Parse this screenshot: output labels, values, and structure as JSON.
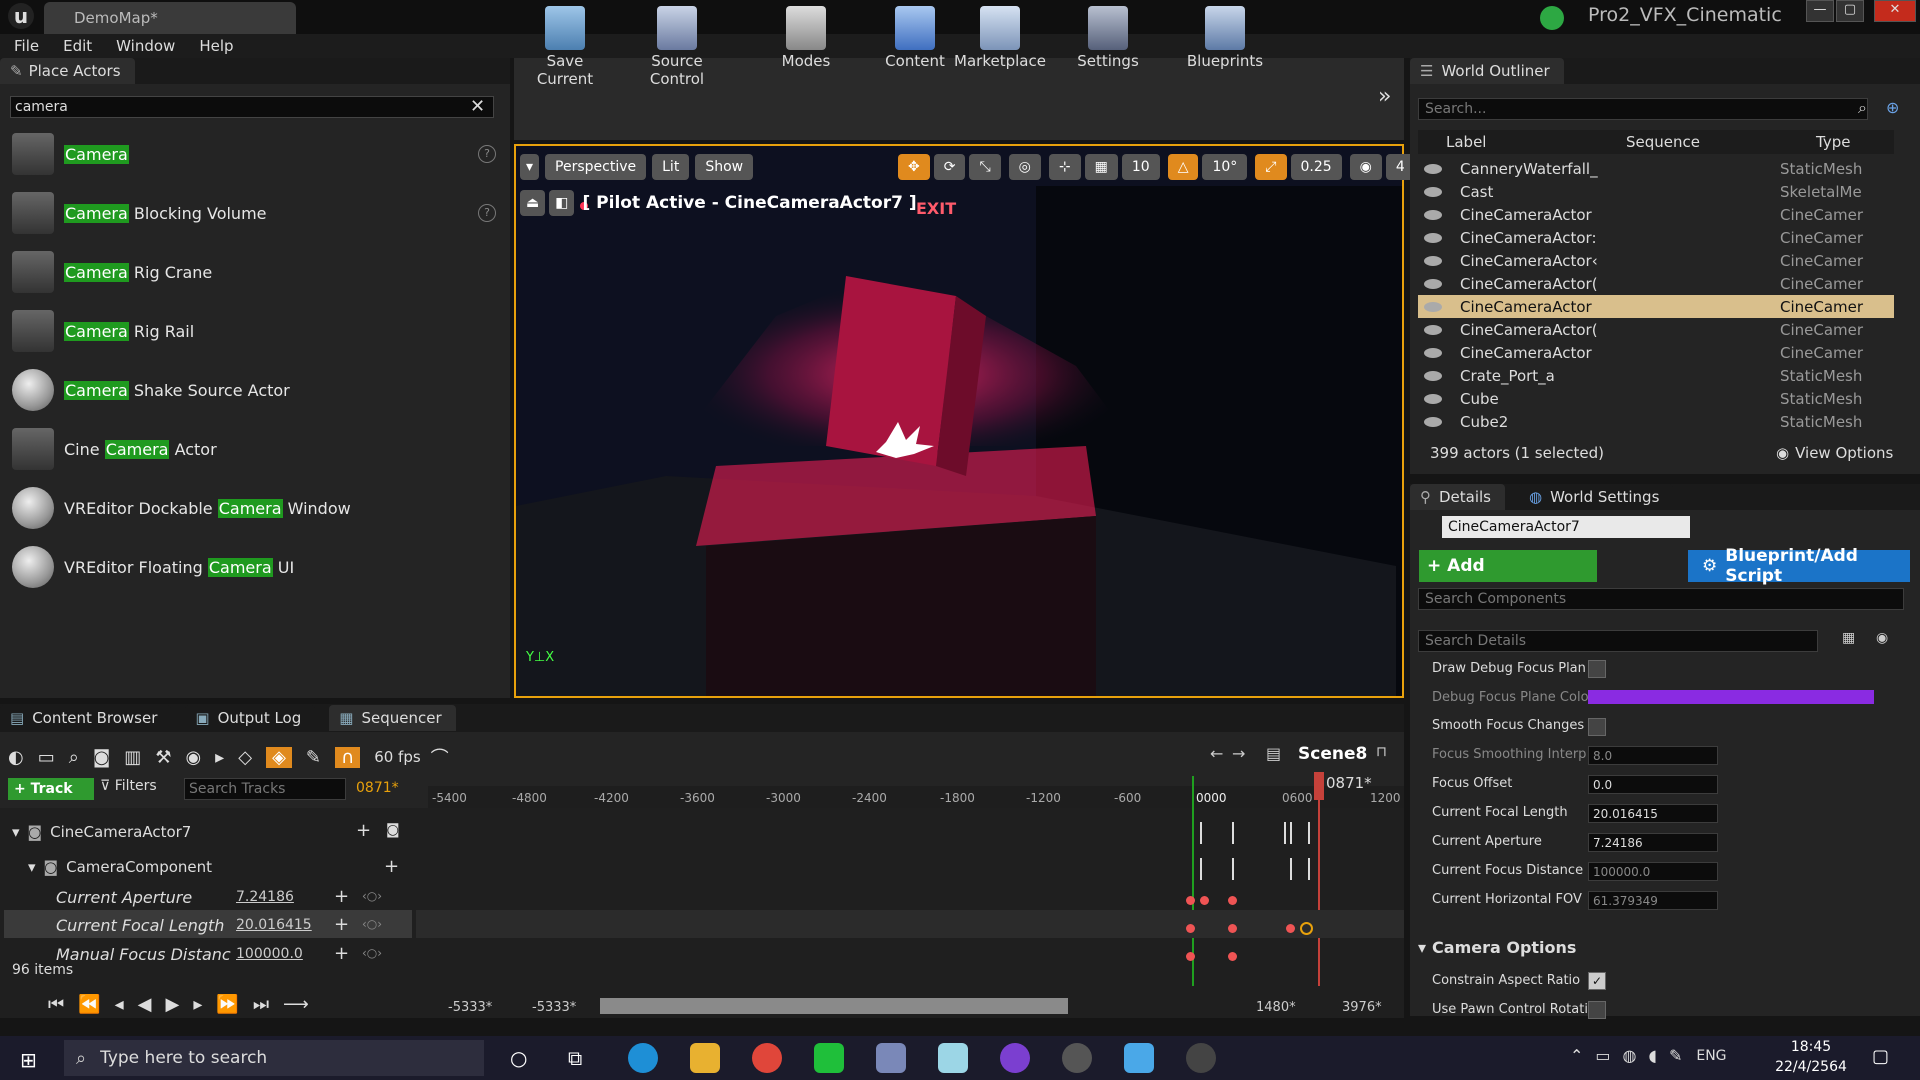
{
  "window": {
    "doc_tab": "DemoMap*",
    "project_name": "Pro2_VFX_Cinematic",
    "min": "—",
    "max": "▢",
    "close": "✕"
  },
  "menu": [
    "File",
    "Edit",
    "Window",
    "Help"
  ],
  "place_actors": {
    "tab": "Place Actors",
    "search_value": "camera",
    "items": [
      {
        "pre": "",
        "hl": "Camera",
        "post": ""
      },
      {
        "pre": "",
        "hl": "Camera",
        "post": " Blocking Volume"
      },
      {
        "pre": "",
        "hl": "Camera",
        "post": " Rig Crane"
      },
      {
        "pre": "",
        "hl": "Camera",
        "post": " Rig Rail"
      },
      {
        "pre": "",
        "hl": "Camera",
        "post": " Shake Source Actor"
      },
      {
        "pre": "Cine ",
        "hl": "Camera",
        "post": " Actor"
      },
      {
        "pre": "VREditor Dockable ",
        "hl": "Camera",
        "post": " Window"
      },
      {
        "pre": "VREditor Floating ",
        "hl": "Camera",
        "post": " UI"
      }
    ]
  },
  "toolbar": [
    "Save Current",
    "Source Control",
    "Modes",
    "Content",
    "Marketplace",
    "Settings",
    "Blueprints"
  ],
  "viewport": {
    "perspective": "Perspective",
    "lit": "Lit",
    "show": "Show",
    "grid": "10",
    "angle": "10°",
    "scale": "0.25",
    "cam_speed": "4",
    "pilot": "[ Pilot Active - CineCameraActor7 ]",
    "exit_sign": "EXIT"
  },
  "outliner": {
    "tab": "World Outliner",
    "search_placeholder": "Search...",
    "col_label": "Label",
    "col_sequence": "Sequence",
    "col_type": "Type",
    "rows": [
      {
        "label": "CanneryWaterfall_",
        "type": "StaticMesh"
      },
      {
        "label": "Cast",
        "type": "SkeletalMe"
      },
      {
        "label": "CineCameraActor",
        "type": "CineCamer"
      },
      {
        "label": "CineCameraActor:",
        "type": "CineCamer"
      },
      {
        "label": "CineCameraActor‹",
        "type": "CineCamer"
      },
      {
        "label": "CineCameraActor(",
        "type": "CineCamer"
      },
      {
        "label": "CineCameraActor",
        "type": "CineCamer"
      },
      {
        "label": "CineCameraActor(",
        "type": "CineCamer"
      },
      {
        "label": "CineCameraActor",
        "type": "CineCamer"
      },
      {
        "label": "Crate_Port_a",
        "type": "StaticMesh"
      },
      {
        "label": "Cube",
        "type": "StaticMesh"
      },
      {
        "label": "Cube2",
        "type": "StaticMesh"
      }
    ],
    "status": "399 actors (1 selected)",
    "view_options": "View Options"
  },
  "details": {
    "tab": "Details",
    "tab2": "World Settings",
    "actor_name": "CineCameraActor7",
    "add_component": "+ Add Component",
    "blueprint": "Blueprint/Add Script",
    "search_components": "Search Components",
    "search_details": "Search Details",
    "props": [
      {
        "label": "Draw Debug Focus Plan"
      },
      {
        "label": "Debug Focus Plane Colo"
      },
      {
        "label": "Smooth Focus Changes"
      },
      {
        "label": "Focus Smoothing Interp",
        "value": "8.0"
      },
      {
        "label": "Focus Offset",
        "value": "0.0"
      },
      {
        "label": "Current Focal Length",
        "value": "20.016415"
      },
      {
        "label": "Current Aperture",
        "value": "7.24186"
      },
      {
        "label": "Current Focus Distance",
        "value": "100000.0"
      },
      {
        "label": "Current Horizontal FOV",
        "value": "61.379349"
      }
    ],
    "camera_options": "Camera Options",
    "constrain": "Constrain Aspect Ratio",
    "use_pawn": "Use Pawn Control Rotatior"
  },
  "bottom_tabs": [
    "Content Browser",
    "Output Log",
    "Sequencer"
  ],
  "sequencer": {
    "fps": "60 fps",
    "scene": "Scene8",
    "track_btn": "Track",
    "filters_btn": "Filters",
    "search_placeholder": "Search Tracks",
    "current_frame": "0871*",
    "playhead_label": "0871*",
    "ruler": [
      "-5400",
      "-4800",
      "-4200",
      "-3600",
      "-3000",
      "-2400",
      "-1800",
      "-1200",
      "-600",
      "0000",
      "0600",
      "1200"
    ],
    "tracks": {
      "actor": "CineCameraActor7",
      "component": "CameraComponent",
      "aperture": {
        "label": "Current Aperture",
        "value": "7.24186"
      },
      "focal": {
        "label": "Current Focal Length",
        "value": "20.016415"
      },
      "manual": {
        "label": "Manual Focus Distanc",
        "value": "100000.0"
      }
    },
    "items_count": "96 items",
    "range": [
      "-5333*",
      "-5333*",
      "1480*",
      "3976*"
    ]
  },
  "taskbar": {
    "search_placeholder": "Type here to search",
    "lang": "ENG",
    "time": "18:45",
    "date": "22/4/2564"
  }
}
